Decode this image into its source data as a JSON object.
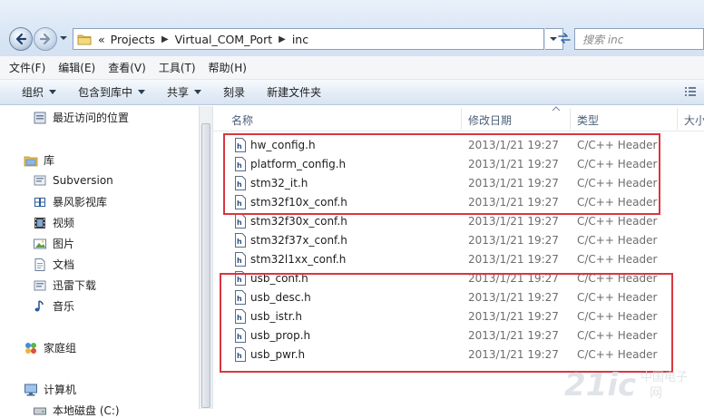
{
  "address": {
    "overflow": "«",
    "crumbs": [
      "Projects",
      "Virtual_COM_Port",
      "inc"
    ],
    "search_placeholder": "搜索 inc"
  },
  "menu": [
    "文件(F)",
    "编辑(E)",
    "查看(V)",
    "工具(T)",
    "帮助(H)"
  ],
  "toolbar": {
    "organize": "组织",
    "include_library": "包含到库中",
    "share": "共享",
    "burn": "刻录",
    "new_folder": "新建文件夹"
  },
  "nav": {
    "recent": "最近访问的位置",
    "libraries": "库",
    "library_items": [
      "Subversion",
      "暴风影视库",
      "视频",
      "图片",
      "文档",
      "迅雷下载",
      "音乐"
    ],
    "homegroup": "家庭组",
    "computer": "计算机",
    "local_disk": "本地磁盘 (C:)"
  },
  "columns": {
    "name": "名称",
    "modified": "修改日期",
    "type": "类型",
    "size": "大小"
  },
  "files": [
    {
      "name": "hw_config.h",
      "date": "2013/1/21 19:27",
      "type": "C/C++ Header"
    },
    {
      "name": "platform_config.h",
      "date": "2013/1/21 19:27",
      "type": "C/C++ Header"
    },
    {
      "name": "stm32_it.h",
      "date": "2013/1/21 19:27",
      "type": "C/C++ Header"
    },
    {
      "name": "stm32f10x_conf.h",
      "date": "2013/1/21 19:27",
      "type": "C/C++ Header"
    },
    {
      "name": "stm32f30x_conf.h",
      "date": "2013/1/21 19:27",
      "type": "C/C++ Header"
    },
    {
      "name": "stm32f37x_conf.h",
      "date": "2013/1/21 19:27",
      "type": "C/C++ Header"
    },
    {
      "name": "stm32l1xx_conf.h",
      "date": "2013/1/21 19:27",
      "type": "C/C++ Header"
    },
    {
      "name": "usb_conf.h",
      "date": "2013/1/21 19:27",
      "type": "C/C++ Header"
    },
    {
      "name": "usb_desc.h",
      "date": "2013/1/21 19:27",
      "type": "C/C++ Header"
    },
    {
      "name": "usb_istr.h",
      "date": "2013/1/21 19:27",
      "type": "C/C++ Header"
    },
    {
      "name": "usb_prop.h",
      "date": "2013/1/21 19:27",
      "type": "C/C++ Header"
    },
    {
      "name": "usb_pwr.h",
      "date": "2013/1/21 19:27",
      "type": "C/C++ Header"
    }
  ],
  "watermark": "21ic 中国电子网",
  "colors": {
    "highlight_box": "#d9363e",
    "accent": "#3a6ea5"
  }
}
